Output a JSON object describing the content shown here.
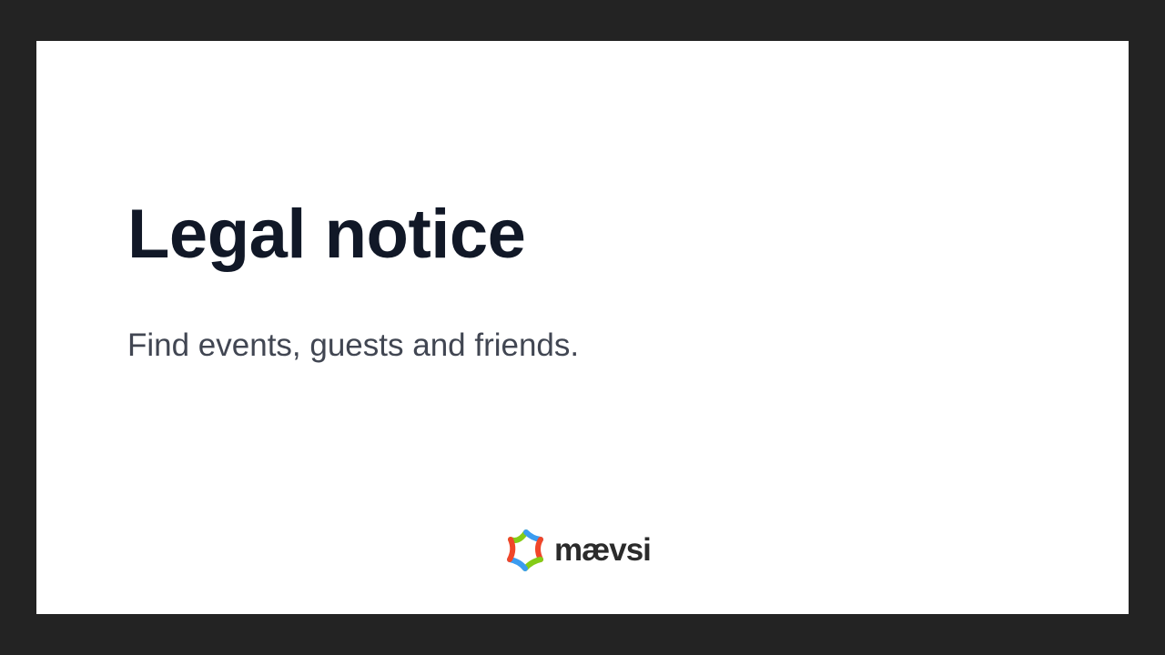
{
  "page": {
    "title": "Legal notice",
    "tagline": "Find events, guests and friends."
  },
  "brand": {
    "name": "mævsi",
    "icon": "maevsi-star-logo-icon"
  },
  "colors": {
    "background": "#232323",
    "card": "#ffffff",
    "title": "#111827",
    "tagline": "#414652",
    "logo_green": "#84cc16",
    "logo_blue": "#3b9cf0",
    "logo_red": "#f0462a"
  }
}
